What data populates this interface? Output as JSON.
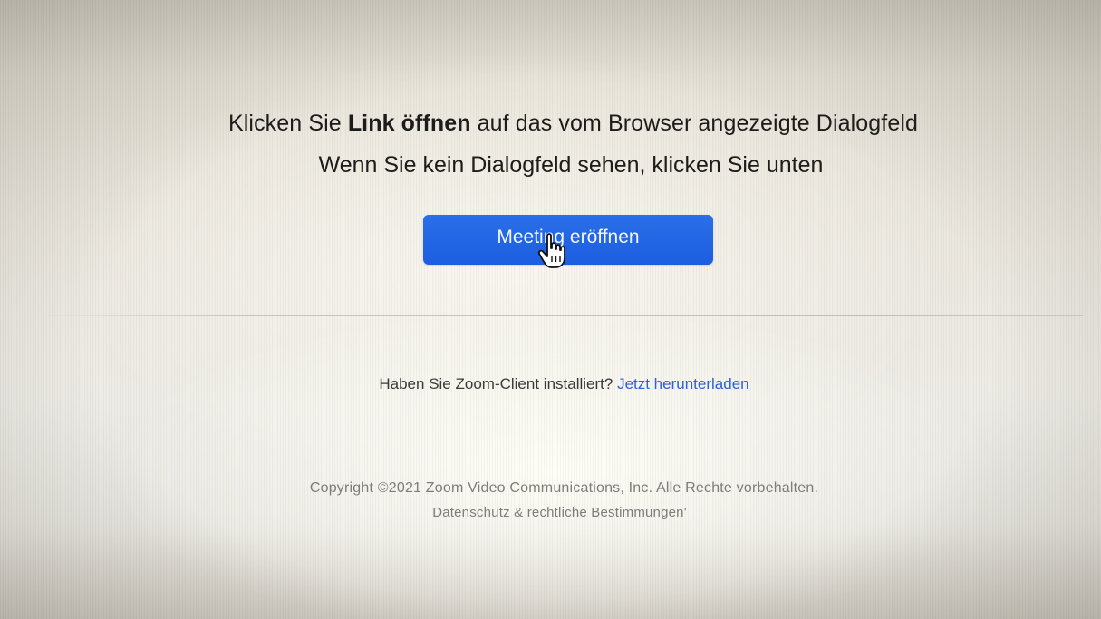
{
  "instructions": {
    "line1_prefix": "Klicken Sie ",
    "line1_bold": "Link öffnen",
    "line1_suffix": " auf das vom Browser angezeigte Dialogfeld",
    "line2": "Wenn Sie kein Dialogfeld sehen, klicken Sie unten"
  },
  "primary_button": {
    "label": "Meeting eröffnen"
  },
  "cursor": {
    "icon": "hand-pointer-icon"
  },
  "client": {
    "question": "Haben Sie Zoom-Client installiert?",
    "download_link": "Jetzt herunterladen"
  },
  "footer": {
    "copyright": "Copyright ©2021 Zoom Video Communications, Inc. Alle Rechte vorbehalten.",
    "privacy_link": "Datenschutz & rechtliche Bestimmungen'"
  },
  "colors": {
    "button": "#1c5ee0",
    "link": "#2d62d6"
  }
}
